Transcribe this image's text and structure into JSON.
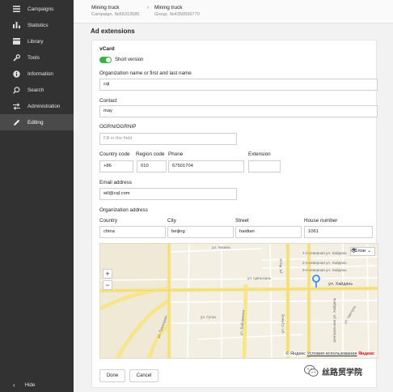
{
  "sidebar": {
    "items": [
      {
        "label": "Campaigns",
        "icon": "menu-icon"
      },
      {
        "label": "Statistics",
        "icon": "bar-chart-icon"
      },
      {
        "label": "Library",
        "icon": "library-icon"
      },
      {
        "label": "Tools",
        "icon": "wrench-icon"
      },
      {
        "label": "Information",
        "icon": "info-icon"
      },
      {
        "label": "Search",
        "icon": "search-icon"
      },
      {
        "label": "Administration",
        "icon": "transfer-icon"
      },
      {
        "label": "Editing",
        "icon": "pencil-icon"
      }
    ],
    "active": "Editing",
    "hide_label": "Hide"
  },
  "breadcrumb": {
    "campaign": {
      "title": "Mining truck",
      "subtitle": "Campaign, №56313585"
    },
    "group": {
      "title": "Mining truck",
      "subtitle": "Group, №4350556770"
    }
  },
  "page": {
    "section_title": "Ad extensions"
  },
  "vcard": {
    "title": "vCard",
    "short_version_label": "Short version",
    "short_version_on": true,
    "org_name_label": "Organization name or first and last name",
    "org_name_value": "cql",
    "contact_label": "Contact",
    "contact_value": "may",
    "ogrn_label": "OGRN/OGRNIP",
    "ogrn_placeholder": "Fill in the field",
    "country_code_label": "Country code",
    "region_code_label": "Region code",
    "phone_label": "Phone",
    "extension_label": "Extension",
    "country_code_value": "+86",
    "region_code_value": "010",
    "phone_value": "67501704",
    "extension_value": "",
    "email_label": "Email address",
    "email_value": "wll@cql.com",
    "org_address_label": "Organization address",
    "country_label": "Country",
    "city_label": "City",
    "street_label": "Street",
    "house_label": "House number",
    "country_value": "china",
    "city_value": "beijing",
    "street_value": "haidian",
    "house_value": "1061"
  },
  "map": {
    "zoom_in": "+",
    "zoom_out": "−",
    "layers_label": "Слои",
    "copyright": "© Яндекс",
    "terms_link": "Условия использования",
    "brand": "Яндекс",
    "street_labels": {
      "pereulok_1": "ул. Чжэнкэ",
      "pereulok_2": "1-я северная ул. Хайдянь",
      "pereulok_3": "2-я северная ул. Хайдянь",
      "pereulok_4": "3-я северная ул. Хайдянь",
      "haidian": "ул. Хайдянь",
      "guanjiang": "ул. Гуаньцзян",
      "gutan": "ул. Гутан",
      "bai": "ул. Байчжэнли",
      "fu": "ул. Фуси",
      "suzhou": "ул. Сучжоу",
      "central": "Центральная ул. Хайдянь",
      "chang": "ул. Чанчунь",
      "xinyuan": "ул. Циньюань"
    }
  },
  "actions": {
    "done_label": "Done",
    "cancel_label": "Cancel"
  },
  "watermark": {
    "text": "丝路贸学院"
  },
  "colors": {
    "sidebar_bg": "#323232",
    "toggle_on": "#3cb043",
    "pin": "#2f8ff5",
    "road_major": "#f6e58a"
  }
}
